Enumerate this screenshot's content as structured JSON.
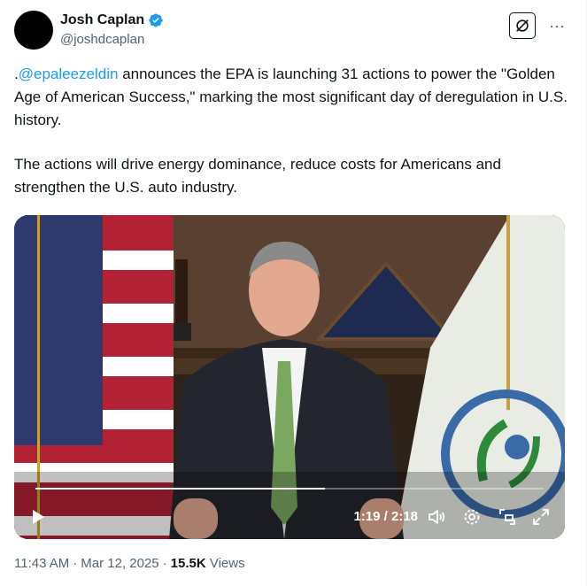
{
  "author": {
    "name": "Josh Caplan",
    "handle": "@joshdcaplan",
    "verified": true,
    "avatar_color": "#000000"
  },
  "header": {
    "grok_icon": "grok-icon",
    "more_icon": "more-horizontal-icon",
    "more_label": "···"
  },
  "tweet": {
    "prefix": ".",
    "mention": "@epaleezeldin",
    "paragraph1_rest": " announces the EPA is launching 31 actions to power the \"Golden Age of American Success,\" marking the most significant day of deregulation in U.S. history.",
    "paragraph2": "The actions will drive energy dominance, reduce costs for Americans and strengthen the U.S. auto industry."
  },
  "video": {
    "current_time": "1:19",
    "duration": "2:18",
    "time_display": "1:19 / 2:18",
    "progress_fraction": 0.57,
    "controls": {
      "play_icon": "play-icon",
      "volume_icon": "volume-icon",
      "settings_icon": "settings-gear-icon",
      "pip_icon": "picture-in-picture-icon",
      "fullscreen_icon": "fullscreen-icon"
    }
  },
  "footer": {
    "time": "11:43 AM",
    "date": "Mar 12, 2025",
    "views_count": "15.5K",
    "views_label": "Views"
  },
  "colors": {
    "accent": "#1d9bf0",
    "text_primary": "#0f1419",
    "text_secondary": "#536471"
  }
}
